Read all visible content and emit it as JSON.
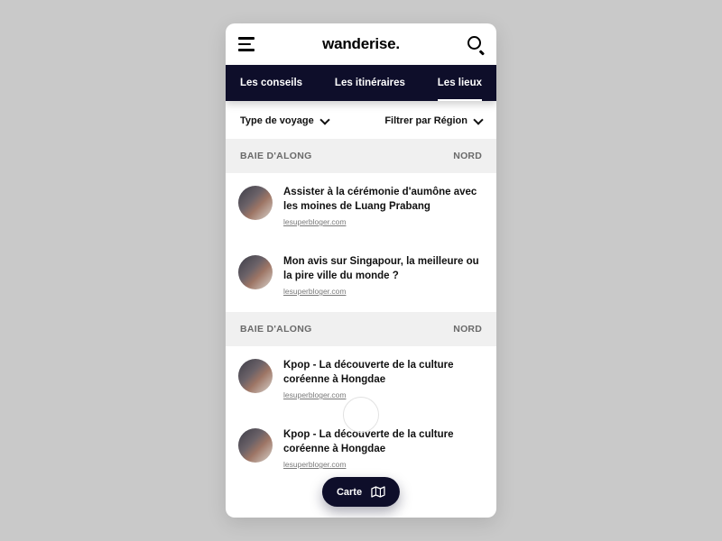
{
  "header": {
    "brand": "wanderise."
  },
  "tabs": [
    {
      "label": "Les conseils",
      "active": false
    },
    {
      "label": "Les itinéraires",
      "active": false
    },
    {
      "label": "Les lieux",
      "active": true
    }
  ],
  "filters": {
    "type_label": "Type de voyage",
    "region_label": "Filtrer par Région"
  },
  "sections": [
    {
      "title": "BAIE D'ALONG",
      "region": "NORD",
      "items": [
        {
          "title": "Assister à la cérémonie d'aumône avec les moines de Luang Prabang",
          "source": "lesuperbloger.com"
        },
        {
          "title": "Mon avis sur Singapour, la meilleure ou la pire ville du monde ?",
          "source": "lesuperbloger.com"
        }
      ]
    },
    {
      "title": "BAIE D'ALONG",
      "region": "NORD",
      "items": [
        {
          "title": "Kpop - La découverte de la culture coréenne à Hongdae",
          "source": "lesuperbloger.com"
        },
        {
          "title": "Kpop - La découverte de la culture coréenne à Hongdae",
          "source": "lesuperbloger.com"
        }
      ]
    }
  ],
  "fab": {
    "label": "Carte"
  }
}
